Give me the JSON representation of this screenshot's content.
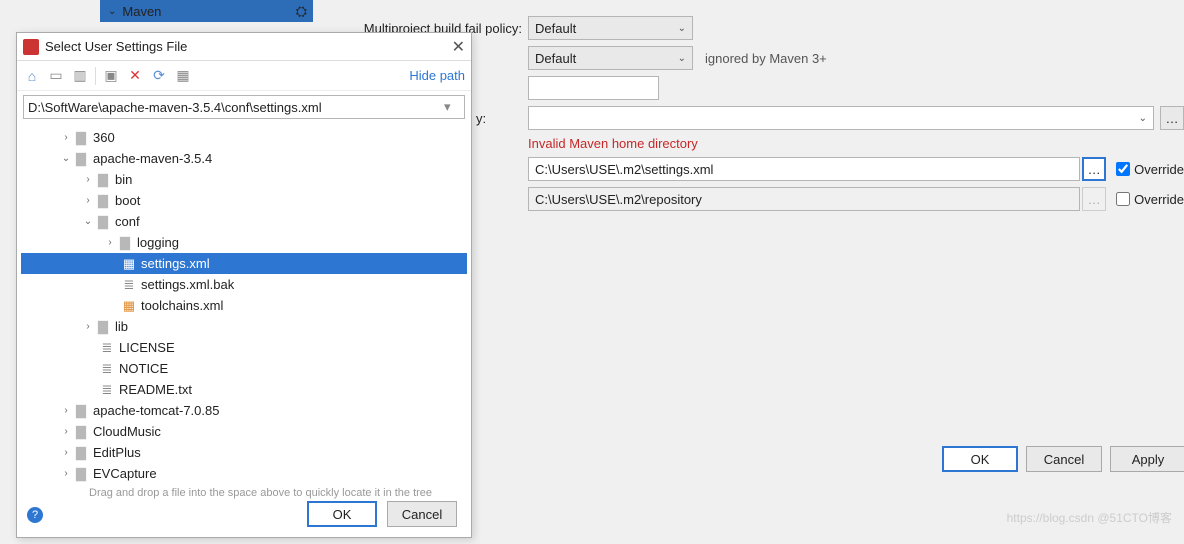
{
  "sidebar": {
    "maven_label": "Maven"
  },
  "form": {
    "policy_label": "Multiproject build fail policy:",
    "policy_value": "Default",
    "second_value": "Default",
    "second_note": "ignored by Maven 3+",
    "y_label": "y:",
    "err": "Invalid Maven home directory",
    "user_settings": "C:\\Users\\USE\\.m2\\settings.xml",
    "local_repo": "C:\\Users\\USE\\.m2\\repository",
    "override1": "Override",
    "override2": "Override"
  },
  "buttons": {
    "ok": "OK",
    "cancel": "Cancel",
    "apply": "Apply"
  },
  "watermark": "https://blog.csdn @51CTO博客",
  "dialog": {
    "title": "Select User Settings File",
    "hide_path": "Hide path",
    "path": "D:\\SoftWare\\apache-maven-3.5.4\\conf\\settings.xml",
    "hint": "Drag and drop a file into the space above to quickly locate it in the tree",
    "ok": "OK",
    "cancel": "Cancel"
  },
  "tree": {
    "n0": "360",
    "n1": "apache-maven-3.5.4",
    "n2": "bin",
    "n3": "boot",
    "n4": "conf",
    "n5": "logging",
    "n6": "settings.xml",
    "n7": "settings.xml.bak",
    "n8": "toolchains.xml",
    "n9": "lib",
    "n10": "LICENSE",
    "n11": "NOTICE",
    "n12": "README.txt",
    "n13": "apache-tomcat-7.0.85",
    "n14": "CloudMusic",
    "n15": "EditPlus",
    "n16": "EVCapture"
  }
}
